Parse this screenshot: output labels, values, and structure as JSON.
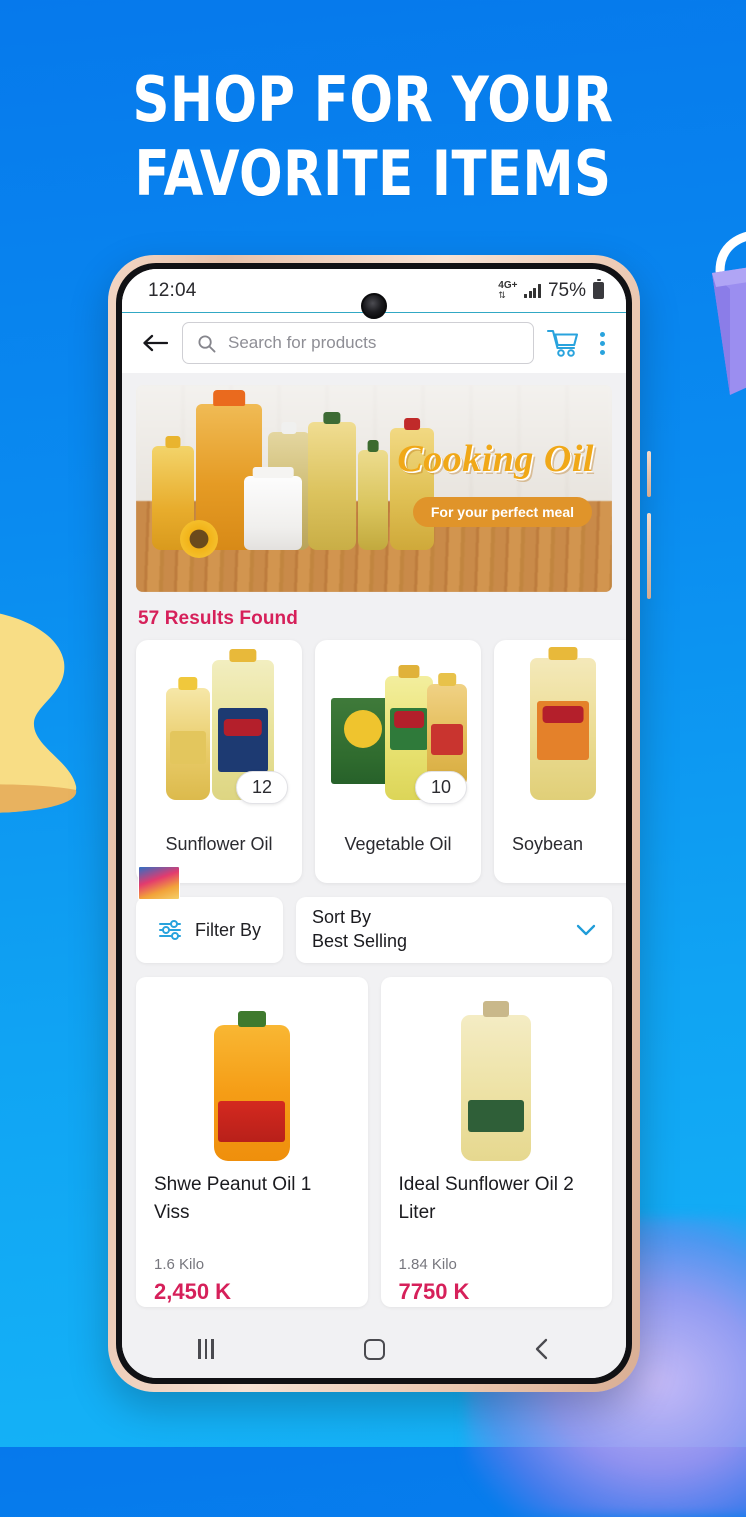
{
  "headline": {
    "line1": "SHOP FOR YOUR",
    "line2": "FAVORITE ITEMS"
  },
  "colors": {
    "background_top": "#0679ec",
    "background_bottom": "#15b3f7",
    "accent_blue": "#29a3dd",
    "accent_pink": "#d6205a",
    "banner_gold": "#f0a818",
    "phone_frame": "#f2d6c4"
  },
  "decorations": {
    "shopping_bag": "shopping-bag-3d",
    "yellow_shape": "yellow-3d-shape",
    "purple_glow": "purple-glow"
  },
  "statusbar": {
    "time": "12:04",
    "network": "4G+",
    "network_arrows": "⇅",
    "signal_icon": "signal-bars-icon",
    "battery_percent": "75%",
    "battery_icon": "battery-icon"
  },
  "appbar": {
    "back_icon": "back-arrow-icon",
    "search": {
      "icon": "search-icon",
      "value": "",
      "placeholder": "Search for products"
    },
    "cart_icon": "shopping-cart-icon",
    "menu_icon": "overflow-menu-icon"
  },
  "banner": {
    "title": "Cooking Oil",
    "tagline": "For your perfect meal",
    "image": "cooking-oil-bottles-banner"
  },
  "results": {
    "count_label": "57 Results Found"
  },
  "categories": [
    {
      "label": "Sunflower Oil",
      "count": "12",
      "image": "sunflower-oil-bottles"
    },
    {
      "label": "Vegetable Oil",
      "count": "10",
      "image": "vegetable-oil-bottles"
    },
    {
      "label": "Soybean",
      "count": "",
      "image": "soybean-oil-bottle"
    }
  ],
  "filter": {
    "icon": "filter-sliders-icon",
    "label": "Filter By"
  },
  "sort": {
    "label": "Sort By",
    "value": "Best Selling",
    "chevron_icon": "chevron-down-icon"
  },
  "products": [
    {
      "name": "Shwe Peanut Oil 1 Viss",
      "weight": "1.6 Kilo",
      "price": "2,450 K",
      "image": "shwe-peanut-oil-bottle"
    },
    {
      "name": "Ideal Sunflower Oil 2 Liter",
      "weight": "1.84 Kilo",
      "price": "7750 K",
      "image": "ideal-sunflower-oil-bottle"
    }
  ],
  "navbar": {
    "recents_icon": "recents-icon",
    "home_icon": "home-icon",
    "back_icon": "back-icon"
  }
}
